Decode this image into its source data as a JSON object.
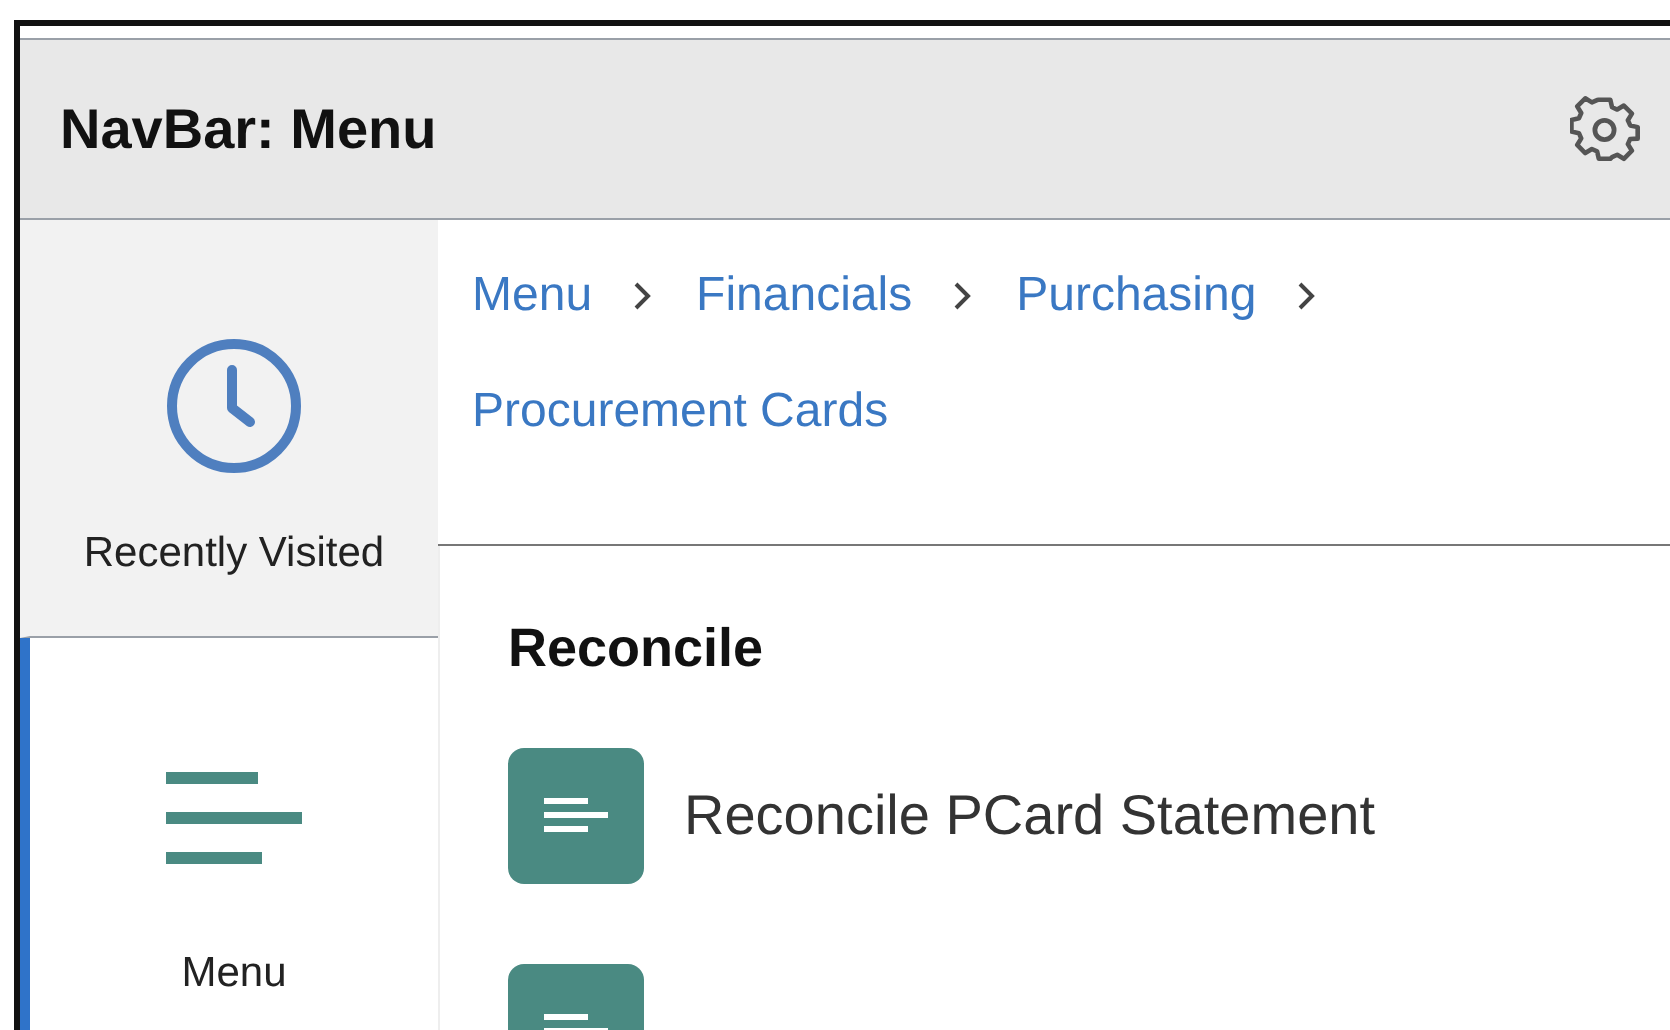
{
  "navbar": {
    "title": "NavBar: Menu"
  },
  "sidebar": {
    "items": [
      {
        "label": "Recently Visited",
        "kind": "clock",
        "selected": false
      },
      {
        "label": "Menu",
        "kind": "menu",
        "selected": true
      }
    ]
  },
  "breadcrumb": [
    {
      "label": "Menu"
    },
    {
      "label": "Financials"
    },
    {
      "label": "Purchasing"
    },
    {
      "label": "Procurement Cards"
    }
  ],
  "section": {
    "title": "Reconcile",
    "items": [
      {
        "kind": "link",
        "label": "Reconcile PCard Statement"
      },
      {
        "kind": "icon"
      }
    ]
  }
}
